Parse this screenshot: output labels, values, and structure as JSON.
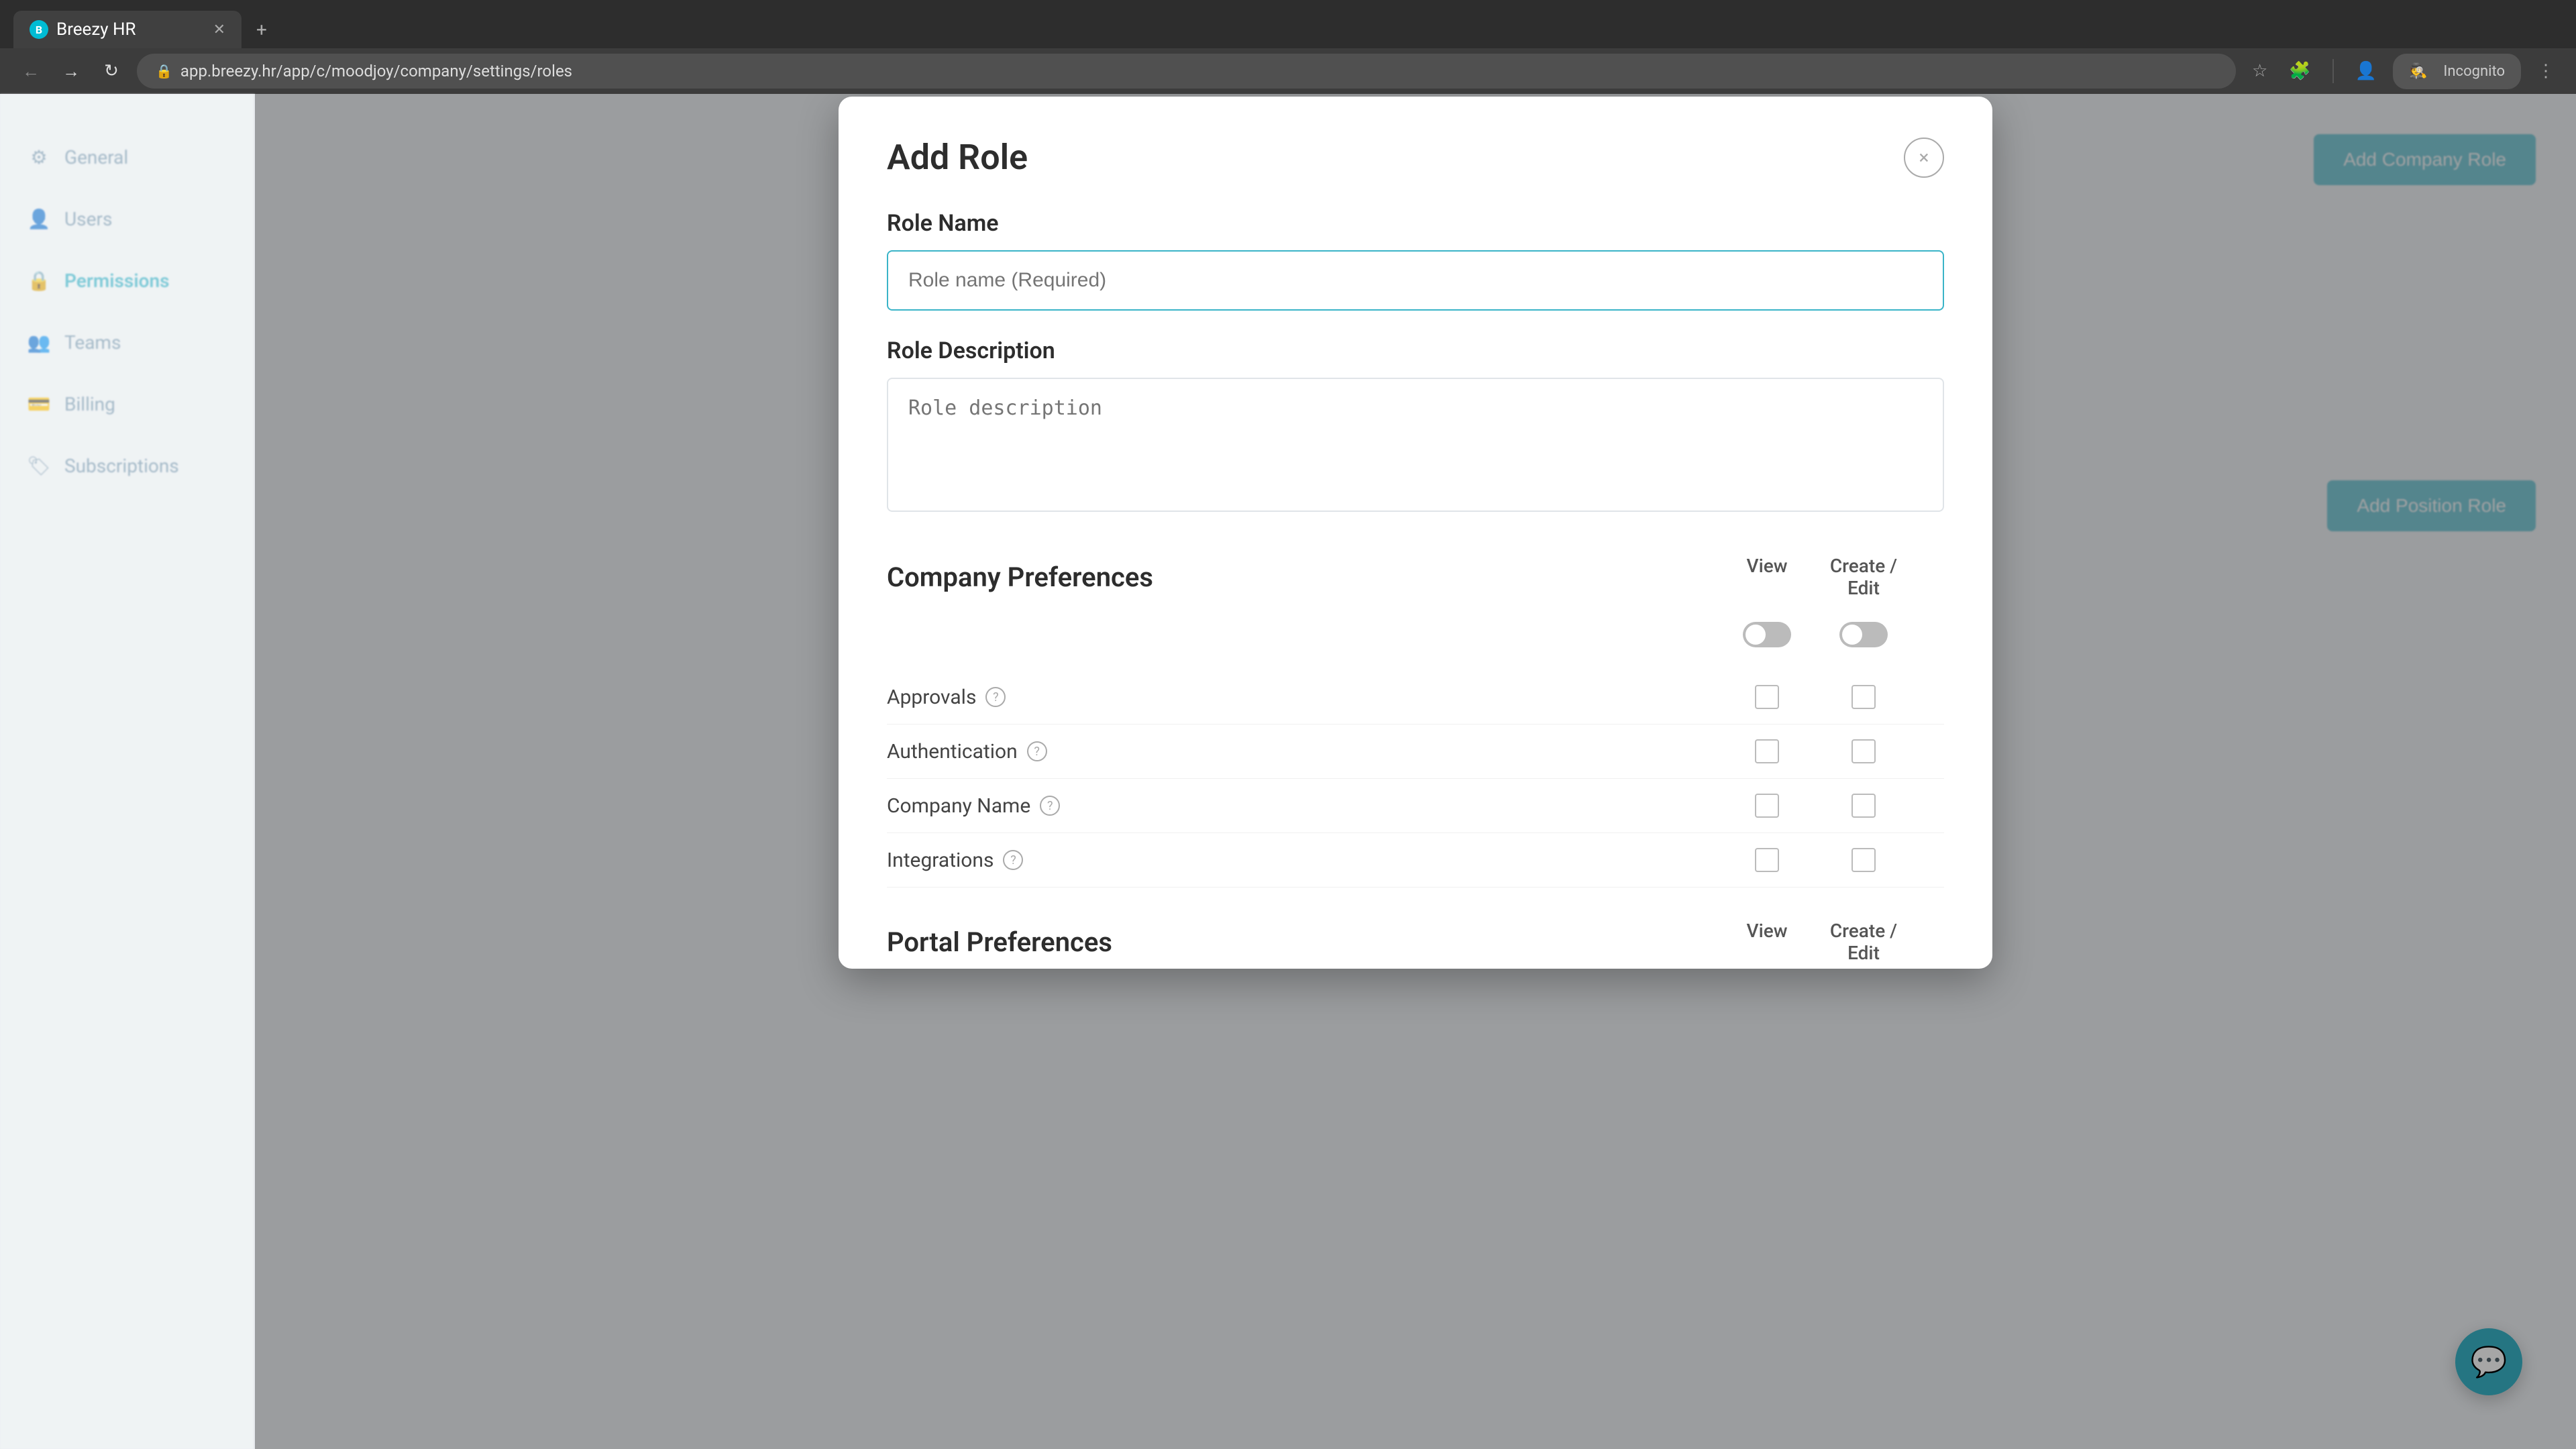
{
  "browser": {
    "tab_label": "Breezy HR",
    "url": "app.breezy.hr/app/c/moodjoy/company/settings/roles",
    "new_tab_label": "+",
    "back_title": "Back",
    "forward_title": "Forward",
    "refresh_title": "Refresh",
    "incognito_label": "Incognito"
  },
  "sidebar": {
    "items": [
      {
        "id": "general",
        "label": "General",
        "icon": "gear"
      },
      {
        "id": "users",
        "label": "Users",
        "icon": "user"
      },
      {
        "id": "permissions",
        "label": "Permissions",
        "icon": "lock",
        "active": true
      },
      {
        "id": "teams",
        "label": "Teams",
        "icon": "users"
      },
      {
        "id": "billing",
        "label": "Billing",
        "icon": "credit-card"
      },
      {
        "id": "subscriptions",
        "label": "Subscriptions",
        "icon": "tag"
      }
    ]
  },
  "background": {
    "add_company_role_label": "Add Company Role",
    "add_position_role_label": "Add Position Role"
  },
  "modal": {
    "title": "Add Role",
    "close_label": "×",
    "role_name_label": "Role Name",
    "role_name_placeholder": "Role name (Required)",
    "role_description_label": "Role Description",
    "role_description_placeholder": "Role description",
    "sections": [
      {
        "id": "company-preferences",
        "title": "Company Preferences",
        "view_label": "View",
        "create_edit_label": "Create / Edit",
        "view_toggle_on": false,
        "create_edit_toggle_on": false,
        "items": [
          {
            "label": "Approvals",
            "has_help": true,
            "view_checked": false,
            "edit_checked": false
          },
          {
            "label": "Authentication",
            "has_help": true,
            "view_checked": false,
            "edit_checked": false
          },
          {
            "label": "Company Name",
            "has_help": true,
            "view_checked": false,
            "edit_checked": false
          },
          {
            "label": "Integrations",
            "has_help": true,
            "view_checked": false,
            "edit_checked": false
          }
        ]
      },
      {
        "id": "portal-preferences",
        "title": "Portal Preferences",
        "view_label": "View",
        "create_edit_label": "Create / Edit",
        "view_toggle_on": true,
        "create_edit_toggle_on": true,
        "items": []
      }
    ]
  },
  "chat": {
    "icon": "💬"
  }
}
